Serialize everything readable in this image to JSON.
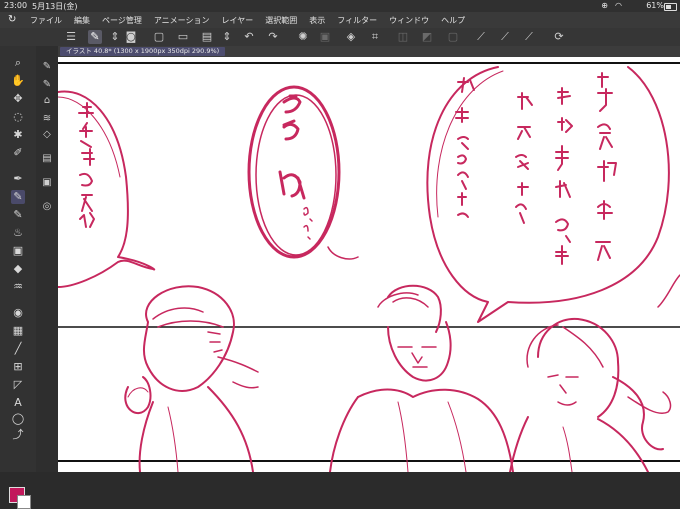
{
  "status_bar": {
    "time": "23:00",
    "date": "5月13日(金)",
    "battery": "61%"
  },
  "menu": {
    "items": [
      "ファイル",
      "編集",
      "ページ管理",
      "アニメーション",
      "レイヤー",
      "選択範囲",
      "表示",
      "フィルター",
      "ウィンドウ",
      "ヘルプ"
    ]
  },
  "document_tab": {
    "label": "イラスト 40.8* (1300 x 1900px 350dpi 290.9%)"
  },
  "colors": {
    "main_color": "#c2185b",
    "sub_color": "#ffffff",
    "ink": "#c7285e"
  }
}
